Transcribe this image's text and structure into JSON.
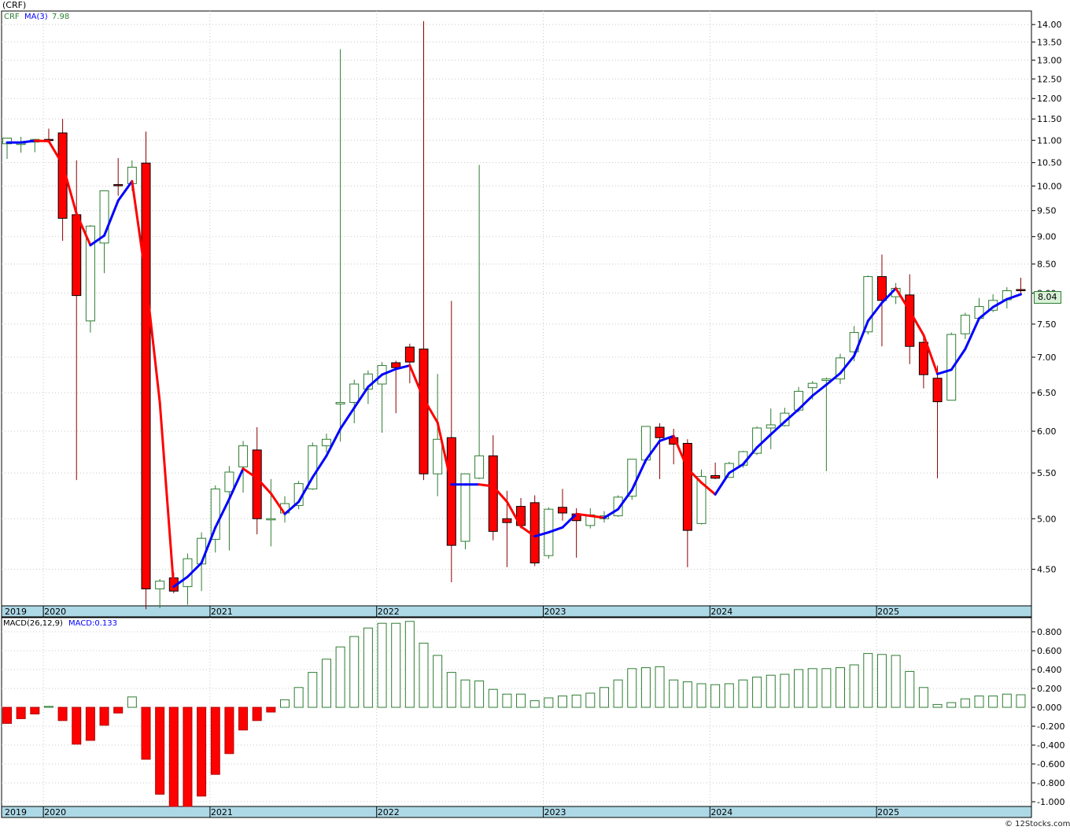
{
  "title": "(CRF)",
  "legend": {
    "symbol": "CRF",
    "ma_label": "MA(3)",
    "ma_value": "7.98",
    "macd_label": "MACD(26,12,9)",
    "macd_value_label": "MACD:0.133"
  },
  "last_price_badge": "8.04",
  "watermark": "© 12Stocks.com",
  "colors": {
    "up": "#2e7d32",
    "down": "#ff0000",
    "ma_up": "#0000ff",
    "ma_down": "#ff0000",
    "axis_band": "#add8e6",
    "badge_bg": "#d8f0d8"
  },
  "chart_data": [
    {
      "type": "candlestick",
      "interval": "monthly",
      "scale": "log",
      "ylim": [
        4.17,
        14.4
      ],
      "y_ticks": [
        "4.50",
        "5.00",
        "5.50",
        "6.00",
        "6.50",
        "7.00",
        "7.50",
        "8.00",
        "8.50",
        "9.00",
        "9.50",
        "10.00",
        "10.50",
        "11.00",
        "11.50",
        "12.00",
        "12.50",
        "13.00",
        "13.50",
        "14.00"
      ],
      "x_year_labels": [
        "2019",
        "2020",
        "2021",
        "2022",
        "2023",
        "2024",
        "2025"
      ],
      "x_year_start_index": [
        0,
        3,
        15,
        27,
        39,
        51,
        63
      ],
      "grid": true,
      "ohlc": [
        [
          10.92,
          11.02,
          10.58,
          11.05
        ],
        [
          10.92,
          11.08,
          10.72,
          10.93
        ],
        [
          10.96,
          11.03,
          10.73,
          11.02
        ],
        [
          11.02,
          11.27,
          11.0,
          11.0
        ],
        [
          11.17,
          11.5,
          8.92,
          9.35
        ],
        [
          9.42,
          10.55,
          5.42,
          7.96
        ],
        [
          7.55,
          9.22,
          7.37,
          9.2
        ],
        [
          8.88,
          9.9,
          8.34,
          9.9
        ],
        [
          10.03,
          10.6,
          9.8,
          10.01
        ],
        [
          10.05,
          10.55,
          9.9,
          10.4
        ],
        [
          10.49,
          11.2,
          4.14,
          4.32
        ],
        [
          4.32,
          4.41,
          4.15,
          4.39
        ],
        [
          4.42,
          4.47,
          4.28,
          4.3
        ],
        [
          4.34,
          4.65,
          4.18,
          4.6
        ],
        [
          4.55,
          4.86,
          4.3,
          4.8
        ],
        [
          4.79,
          5.36,
          4.66,
          5.32
        ],
        [
          5.29,
          5.58,
          4.68,
          5.51
        ],
        [
          5.57,
          5.88,
          5.28,
          5.82
        ],
        [
          5.77,
          6.05,
          4.84,
          5.0
        ],
        [
          5.0,
          5.43,
          4.72,
          5.0
        ],
        [
          5.06,
          5.24,
          4.96,
          5.16
        ],
        [
          5.14,
          5.41,
          5.1,
          5.38
        ],
        [
          5.32,
          5.86,
          5.31,
          5.82
        ],
        [
          5.82,
          5.97,
          5.74,
          5.9
        ],
        [
          6.35,
          13.3,
          5.87,
          6.37
        ],
        [
          6.37,
          6.68,
          6.1,
          6.62
        ],
        [
          6.55,
          6.81,
          6.35,
          6.76
        ],
        [
          6.62,
          6.93,
          5.98,
          6.88
        ],
        [
          6.92,
          6.95,
          6.23,
          6.85
        ],
        [
          7.15,
          7.2,
          6.63,
          6.93
        ],
        [
          7.12,
          14.1,
          5.42,
          5.49
        ],
        [
          5.49,
          6.76,
          5.24,
          5.9
        ],
        [
          5.92,
          7.87,
          4.38,
          4.73
        ],
        [
          4.77,
          5.47,
          4.69,
          5.49
        ],
        [
          5.44,
          10.45,
          5.43,
          5.7
        ],
        [
          5.7,
          5.95,
          4.78,
          4.87
        ],
        [
          5.0,
          5.3,
          4.52,
          4.96
        ],
        [
          5.13,
          5.22,
          4.9,
          4.93
        ],
        [
          5.17,
          5.25,
          4.53,
          4.56
        ],
        [
          4.63,
          5.12,
          4.6,
          5.1
        ],
        [
          5.12,
          5.32,
          4.98,
          5.06
        ],
        [
          5.05,
          5.11,
          4.61,
          4.98
        ],
        [
          4.93,
          5.11,
          4.9,
          5.04
        ],
        [
          5.0,
          5.08,
          4.96,
          5.03
        ],
        [
          5.03,
          5.25,
          5.02,
          5.23
        ],
        [
          5.24,
          5.65,
          5.2,
          5.66
        ],
        [
          5.65,
          6.06,
          5.61,
          6.06
        ],
        [
          6.05,
          6.1,
          5.43,
          5.92
        ],
        [
          5.92,
          6.03,
          5.6,
          5.84
        ],
        [
          5.85,
          5.9,
          4.52,
          4.88
        ],
        [
          4.95,
          5.54,
          4.94,
          5.46
        ],
        [
          5.47,
          5.62,
          5.43,
          5.44
        ],
        [
          5.45,
          5.63,
          5.46,
          5.61
        ],
        [
          5.59,
          5.76,
          5.56,
          5.75
        ],
        [
          5.73,
          6.06,
          5.71,
          6.04
        ],
        [
          6.04,
          6.29,
          5.78,
          6.08
        ],
        [
          6.07,
          6.3,
          6.06,
          6.23
        ],
        [
          6.27,
          6.58,
          6.24,
          6.52
        ],
        [
          6.57,
          6.66,
          6.41,
          6.63
        ],
        [
          6.67,
          6.71,
          5.52,
          6.69
        ],
        [
          6.69,
          7.05,
          6.62,
          6.99
        ],
        [
          7.08,
          7.47,
          6.94,
          7.37
        ],
        [
          7.38,
          8.3,
          7.34,
          8.28
        ],
        [
          8.28,
          8.67,
          7.16,
          7.88
        ],
        [
          7.94,
          8.17,
          7.82,
          8.08
        ],
        [
          7.97,
          8.32,
          6.9,
          7.16
        ],
        [
          7.22,
          7.31,
          6.56,
          6.75
        ],
        [
          6.7,
          6.88,
          5.44,
          6.38
        ],
        [
          6.4,
          7.37,
          6.41,
          7.34
        ],
        [
          7.35,
          7.68,
          7.27,
          7.64
        ],
        [
          7.59,
          7.92,
          7.58,
          7.78
        ],
        [
          7.72,
          7.98,
          7.69,
          7.88
        ],
        [
          7.89,
          8.1,
          7.75,
          8.04
        ],
        [
          8.06,
          8.26,
          7.98,
          8.04
        ]
      ],
      "ma3": [
        10.95,
        10.95,
        10.99,
        10.98,
        10.46,
        9.44,
        8.84,
        9.02,
        9.7,
        10.1,
        8.24,
        6.37,
        4.34,
        4.43,
        4.56,
        4.91,
        5.21,
        5.55,
        5.44,
        5.27,
        5.05,
        5.18,
        5.45,
        5.7,
        6.03,
        6.3,
        6.58,
        6.75,
        6.83,
        6.88,
        6.42,
        6.11,
        5.37,
        5.37,
        5.37,
        5.35,
        5.18,
        4.92,
        4.82,
        4.86,
        4.91,
        5.05,
        5.03,
        5.01,
        5.1,
        5.31,
        5.65,
        5.88,
        5.94,
        5.55,
        5.39,
        5.26,
        5.5,
        5.6,
        5.8,
        5.96,
        6.12,
        6.28,
        6.46,
        6.61,
        6.77,
        7.02,
        7.55,
        7.84,
        8.08,
        7.71,
        7.33,
        6.76,
        6.82,
        7.12,
        7.59,
        7.77,
        7.9,
        7.98
      ],
      "ma3_color_segments": "blue where rising, red where falling"
    },
    {
      "type": "bar",
      "name_label": "MACD(26,12,9)",
      "ylim": [
        -1.05,
        0.95
      ],
      "y_ticks": [
        "0.800",
        "0.600",
        "0.400",
        "0.200",
        "0.000",
        "-0.200",
        "-0.400",
        "-0.600",
        "-0.800",
        "-1.000"
      ],
      "x_year_labels": [
        "2019",
        "2020",
        "2021",
        "2022",
        "2023",
        "2024",
        "2025"
      ],
      "values": [
        -0.17,
        -0.12,
        -0.07,
        0.01,
        -0.14,
        -0.39,
        -0.35,
        -0.19,
        -0.06,
        0.11,
        -0.55,
        -0.92,
        -1.05,
        -1.05,
        -0.94,
        -0.71,
        -0.49,
        -0.24,
        -0.14,
        -0.05,
        0.08,
        0.21,
        0.37,
        0.51,
        0.64,
        0.75,
        0.84,
        0.89,
        0.89,
        0.91,
        0.68,
        0.55,
        0.37,
        0.29,
        0.28,
        0.19,
        0.14,
        0.14,
        0.07,
        0.1,
        0.12,
        0.13,
        0.15,
        0.21,
        0.29,
        0.41,
        0.42,
        0.43,
        0.29,
        0.27,
        0.25,
        0.24,
        0.25,
        0.29,
        0.32,
        0.34,
        0.35,
        0.4,
        0.41,
        0.41,
        0.42,
        0.45,
        0.57,
        0.56,
        0.55,
        0.38,
        0.21,
        0.03,
        0.05,
        0.09,
        0.12,
        0.12,
        0.14,
        0.133
      ]
    }
  ]
}
